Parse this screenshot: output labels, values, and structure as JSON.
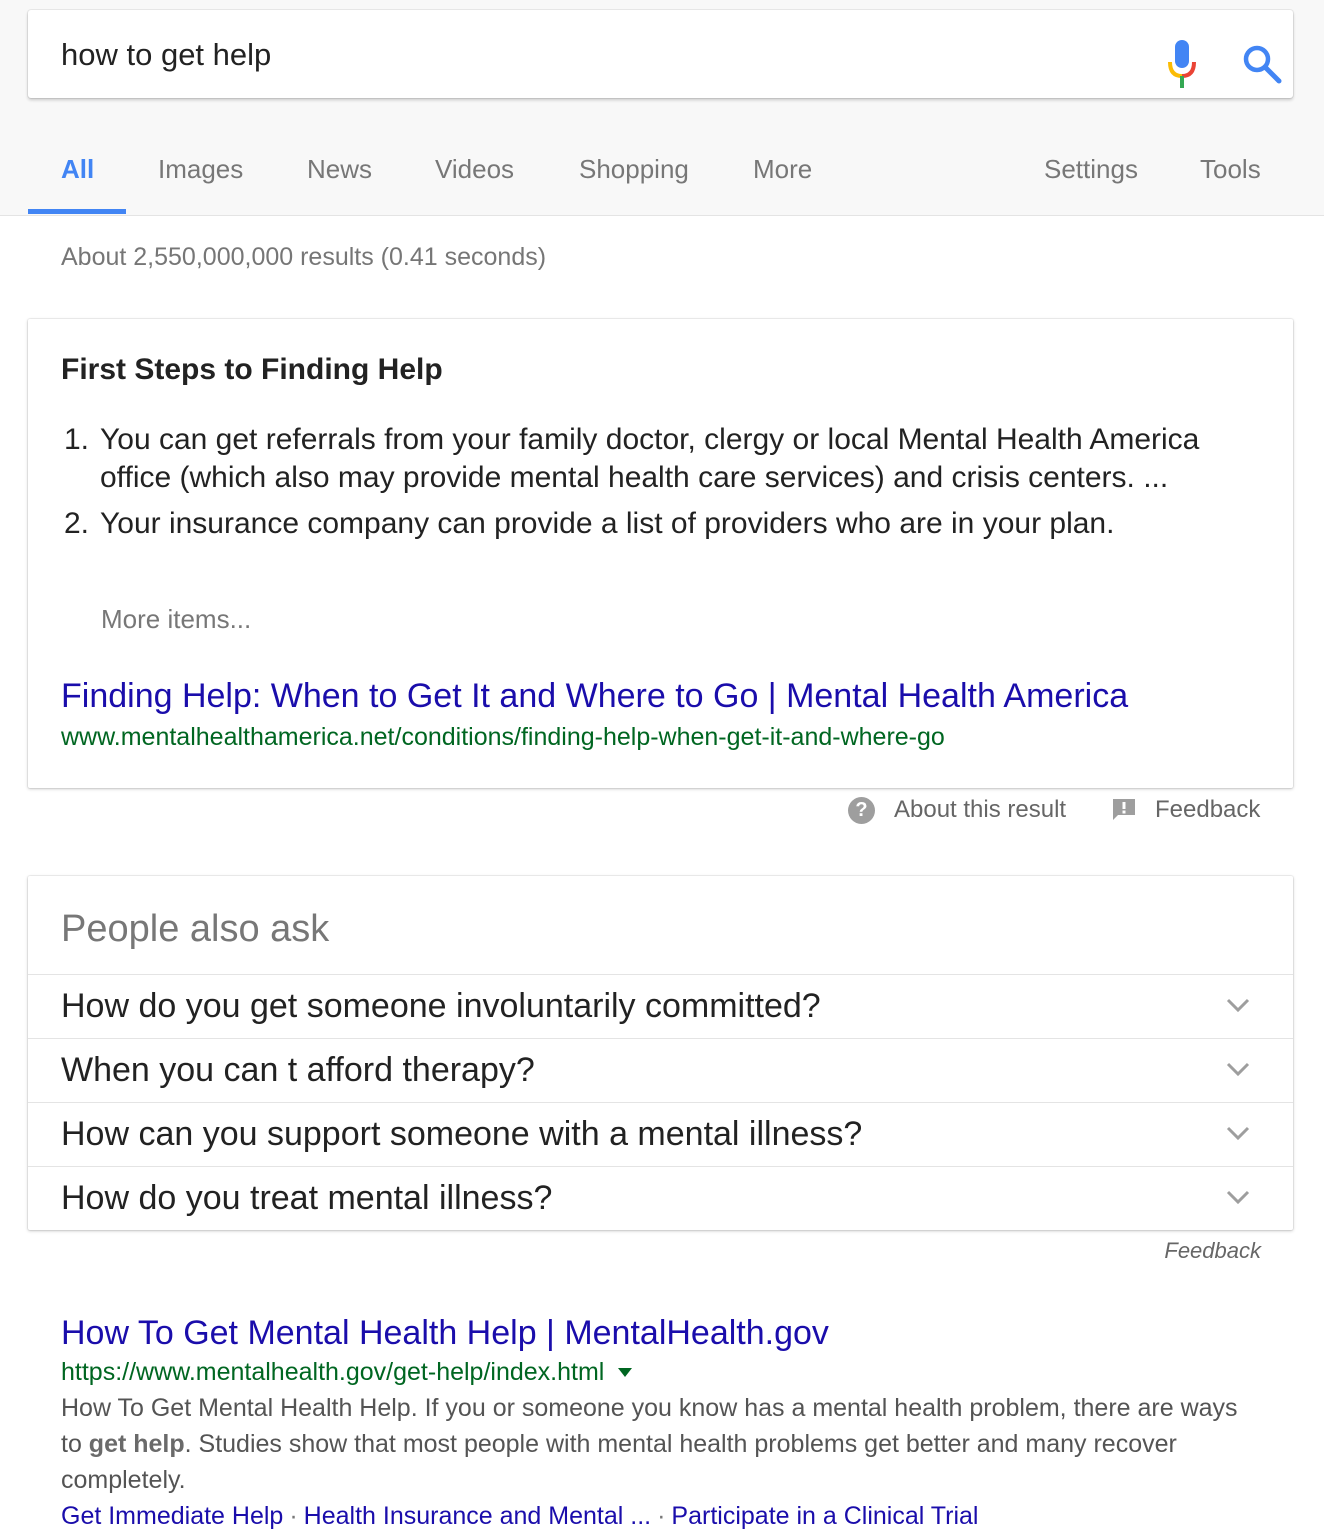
{
  "search": {
    "query": "how to get help"
  },
  "tabs": [
    {
      "label": "All"
    },
    {
      "label": "Images"
    },
    {
      "label": "News"
    },
    {
      "label": "Videos"
    },
    {
      "label": "Shopping"
    },
    {
      "label": "More"
    },
    {
      "label": "Settings"
    },
    {
      "label": "Tools"
    }
  ],
  "stats": "About 2,550,000,000 results (0.41 seconds)",
  "featured_snippet": {
    "title": "First Steps to Finding Help",
    "items": [
      {
        "num": "1.",
        "text": "You can get referrals from your family doctor, clergy or local Mental Health America office (which also may provide mental health care services) and crisis centers. ..."
      },
      {
        "num": "2.",
        "text": "Your insurance company can provide a list of providers who are in your plan."
      }
    ],
    "more_items": "More items...",
    "link_title": "Finding Help: When to Get It and Where to Go | Mental Health America",
    "url": "www.mentalhealthamerica.net/conditions/finding-help-when-get-it-and-where-go",
    "about_label": "About this result",
    "feedback_label": "Feedback"
  },
  "people_also_ask": {
    "title": "People also ask",
    "questions": [
      "How do you get someone involuntarily committed?",
      "When you can t afford therapy?",
      "How can you support someone with a mental illness?",
      "How do you treat mental illness?"
    ],
    "feedback_label": "Feedback"
  },
  "result": {
    "title": "How To Get Mental Health Help | MentalHealth.gov",
    "url": "https://www.mentalhealth.gov/get-help/index.html",
    "desc_part1": "How To Get Mental Health Help. If you or someone you know has a mental health problem, there are ways to ",
    "desc_bold": "get help",
    "desc_part2": ". Studies show that most people with mental health problems get better and many recover completely.",
    "sitelinks": [
      "Get Immediate Help",
      "Health Insurance and Mental ...",
      "Participate in a Clinical Trial"
    ],
    "separator": "·"
  },
  "colors": {
    "accent": "#4285f4",
    "link": "#1a0dab",
    "url": "#006621"
  }
}
